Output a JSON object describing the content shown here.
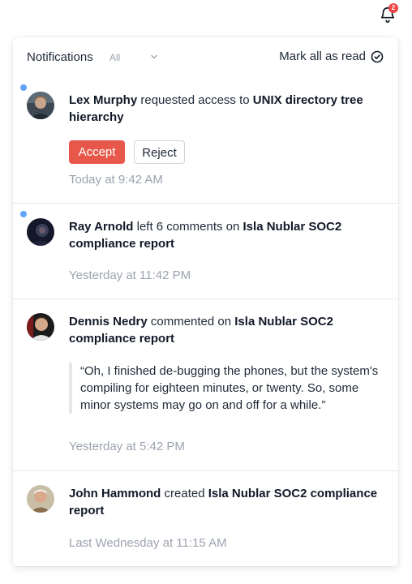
{
  "bell": {
    "badge_count": "2",
    "icon": "bell-icon"
  },
  "header": {
    "title": "Notifications",
    "filter_value": "All",
    "mark_all_label": "Mark all as read"
  },
  "notifications": [
    {
      "unread": true,
      "actor": "Lex Murphy",
      "action": " requested access to ",
      "target": "UNIX directory tree hierarchy",
      "accept_label": "Accept",
      "reject_label": "Reject",
      "time": "Today at 9:42 AM"
    },
    {
      "unread": true,
      "actor": "Ray Arnold",
      "action": " left 6 comments on ",
      "target": "Isla Nublar SOC2 compliance report",
      "time": "Yesterday at 11:42 PM"
    },
    {
      "unread": false,
      "actor": "Dennis Nedry",
      "action": " commented on ",
      "target": "Isla Nublar SOC2 compliance report",
      "quote": "“Oh, I finished de-bugging the phones, but the system's compiling for eighteen minutes, or twenty.  So, some minor systems may go on and off for a while.”",
      "time": "Yesterday at 5:42 PM"
    },
    {
      "unread": false,
      "actor": "John Hammond",
      "action": " created ",
      "target": "Isla Nublar SOC2 compliance report",
      "time": "Last Wednesday at 11:15 AM"
    }
  ],
  "colors": {
    "accept": "#e8584a",
    "unread_dot": "#60a5fa",
    "badge": "#ef4444",
    "muted_text": "#9ca3af"
  }
}
